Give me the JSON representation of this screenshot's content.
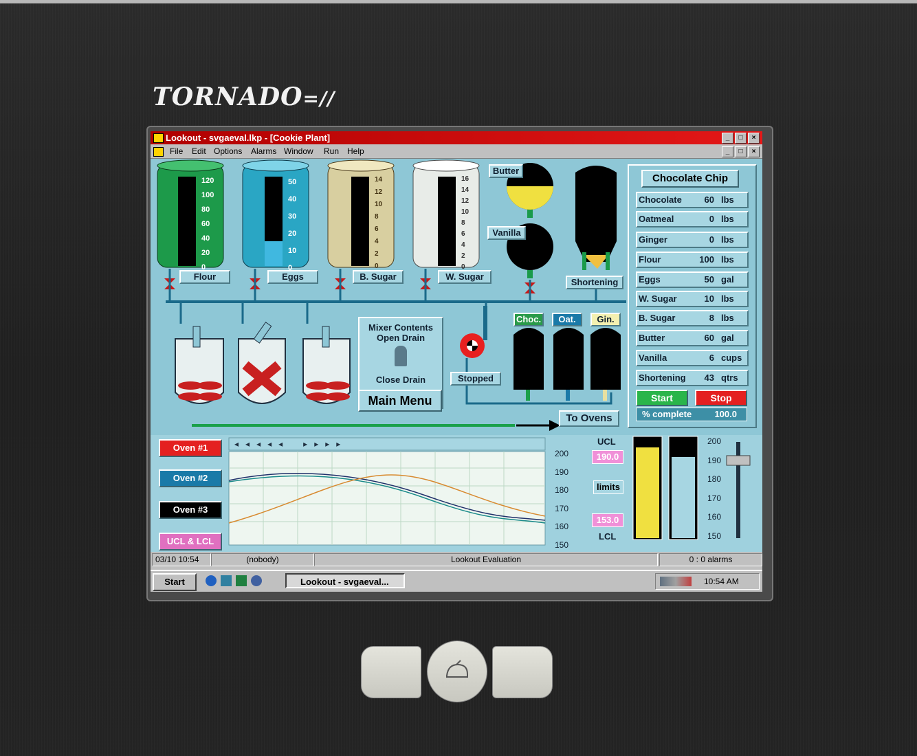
{
  "device": {
    "brand": "TORNADO",
    "brand_suffix": "=//"
  },
  "window": {
    "title": "Lookout - svgaeval.lkp - [Cookie Plant]",
    "controls": [
      "_",
      "□",
      "×"
    ]
  },
  "menu": [
    "File",
    "Edit",
    "Options",
    "Alarms",
    "Window",
    "Run",
    "Help"
  ],
  "tanks": [
    {
      "name": "Flour",
      "ticks": [
        "120",
        "100",
        "80",
        "60",
        "40",
        "20",
        "0"
      ],
      "level": 0.0,
      "color": "#1d9a4a"
    },
    {
      "name": "Eggs",
      "ticks": [
        "50",
        "40",
        "30",
        "20",
        "10",
        "0"
      ],
      "level": 0.2,
      "color": "#2aa6c4"
    },
    {
      "name": "B. Sugar",
      "ticks": [
        "14",
        "12",
        "10",
        "8",
        "6",
        "4",
        "2",
        "0"
      ],
      "level": 0.0,
      "color": "#d8cfa0"
    },
    {
      "name": "W. Sugar",
      "ticks": [
        "16",
        "14",
        "12",
        "10",
        "8",
        "6",
        "4",
        "2",
        "0"
      ],
      "level": 0.0,
      "color": "#e8ece8"
    }
  ],
  "hoppers": {
    "butter": "Butter",
    "vanilla": "Vanilla",
    "shortening": "Shortening"
  },
  "mixer_panel": {
    "line1": "Mixer Contents",
    "line2": "Open Drain",
    "line3": "Close Drain"
  },
  "main_menu": "Main Menu",
  "pump_status": "Stopped",
  "bins": [
    {
      "name": "Choc.",
      "color": "#2a9a4a"
    },
    {
      "name": "Oat.",
      "color": "#1a7aa8"
    },
    {
      "name": "Gin.",
      "color": "#f4f0b0"
    }
  ],
  "to_ovens": "To Ovens",
  "recipe": {
    "title": "Chocolate Chip",
    "rows": [
      {
        "name": "Chocolate",
        "qty": "60",
        "unit": "lbs"
      },
      {
        "name": "Oatmeal",
        "qty": "0",
        "unit": "lbs"
      },
      {
        "name": "Ginger",
        "qty": "0",
        "unit": "lbs"
      },
      {
        "name": "Flour",
        "qty": "100",
        "unit": "lbs"
      },
      {
        "name": "Eggs",
        "qty": "50",
        "unit": "gal"
      },
      {
        "name": "W. Sugar",
        "qty": "10",
        "unit": "lbs"
      },
      {
        "name": "B. Sugar",
        "qty": "8",
        "unit": "lbs"
      },
      {
        "name": "Butter",
        "qty": "60",
        "unit": "gal"
      },
      {
        "name": "Vanilla",
        "qty": "6",
        "unit": "cups"
      },
      {
        "name": "Shortening",
        "qty": "43",
        "unit": "qtrs"
      }
    ],
    "start": "Start",
    "stop": "Stop",
    "complete_label": "% complete",
    "complete_value": "100.0"
  },
  "ovens": [
    "Oven #1",
    "Oven #2",
    "Oven #3",
    "UCL & LCL"
  ],
  "trend": {
    "y_ticks": [
      "200",
      "190",
      "180",
      "170",
      "160",
      "150"
    ],
    "ucl_label": "UCL",
    "ucl_value": "190.0",
    "limits_label": "limits",
    "lcl_value": "153.0",
    "lcl_label": "LCL",
    "nav": [
      "◂",
      "◂",
      "◂",
      "◂",
      "◂",
      "▸",
      "▸",
      "▸",
      "▸"
    ]
  },
  "bargraph": {
    "ticks": [
      "200",
      "190",
      "180",
      "170",
      "160",
      "150"
    ]
  },
  "status": {
    "timestamp": "03/10 10:54",
    "user": "(nobody)",
    "mode": "Lookout Evaluation",
    "alarms": "0 : 0 alarms"
  },
  "taskbar": {
    "start": "Start",
    "task": "Lookout - svgaeval...",
    "clock": "10:54 AM"
  },
  "colors": {
    "hmi_bg": "#8ec7d6",
    "title_red": "#d40000",
    "start_green": "#2ab54a",
    "stop_red": "#e42020"
  }
}
